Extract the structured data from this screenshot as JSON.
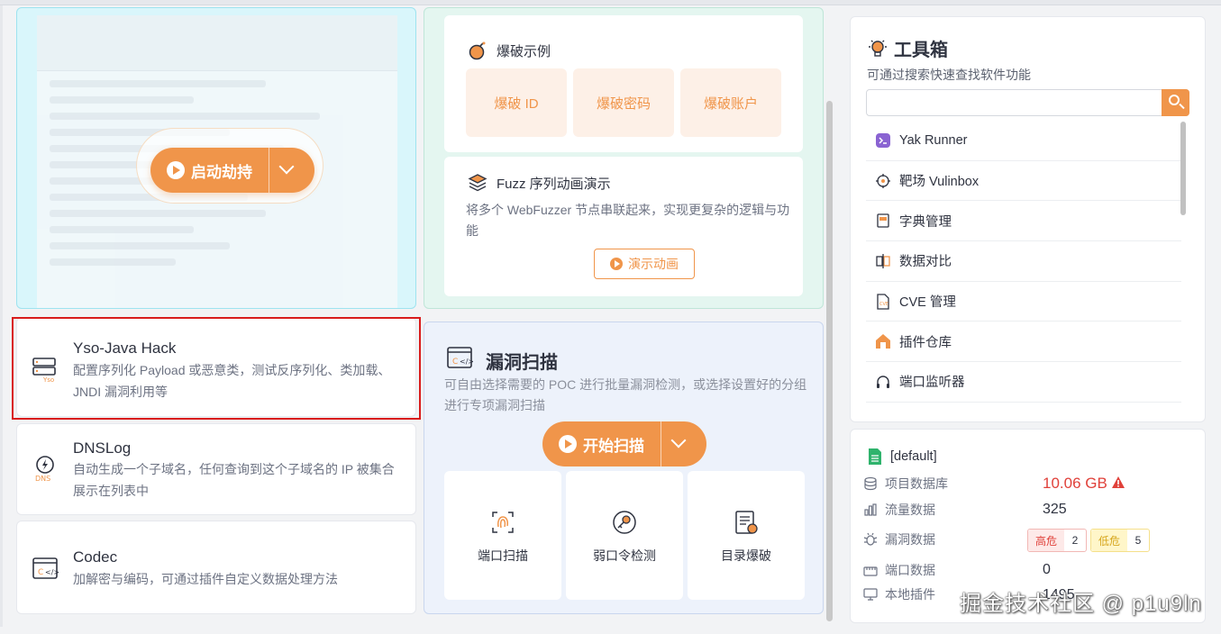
{
  "launch": {
    "start_label": "启动劫持"
  },
  "tools_left": {
    "yso": {
      "title": "Yso-Java Hack",
      "desc": "配置序列化 Payload 或恶意类，测试反序列化、类加载、JNDI 漏洞利用等"
    },
    "dnslog": {
      "title": "DNSLog",
      "desc": "自动生成一个子域名，任何查询到这个子域名的 IP 被集合展示在列表中"
    },
    "codec": {
      "title": "Codec",
      "desc": "加解密与编码，可通过插件自定义数据处理方法"
    }
  },
  "brute_example": {
    "title": "爆破示例",
    "tiles": [
      "爆破 ID",
      "爆破密码",
      "爆破账户"
    ]
  },
  "fuzz_demo": {
    "title": "Fuzz 序列动画演示",
    "desc": "将多个 WebFuzzer 节点串联起来，实现更复杂的逻辑与功能",
    "button": "演示动画"
  },
  "vuln_scan": {
    "title": "漏洞扫描",
    "desc": "可自由选择需要的 POC 进行批量漏洞检测，或选择设置好的分组进行专项漏洞扫描",
    "start_label": "开始扫描",
    "tiles": [
      "端口扫描",
      "弱口令检测",
      "目录爆破"
    ]
  },
  "toolbox": {
    "title": "工具箱",
    "subtitle": "可通过搜索快速查找软件功能",
    "search_value": "",
    "items": [
      {
        "label": "Yak Runner",
        "icon": "terminal-icon"
      },
      {
        "label": "靶场 Vulinbox",
        "icon": "target-icon"
      },
      {
        "label": "字典管理",
        "icon": "dictionary-icon"
      },
      {
        "label": "数据对比",
        "icon": "compare-icon"
      },
      {
        "label": "CVE 管理",
        "icon": "cve-icon"
      },
      {
        "label": "插件仓库",
        "icon": "store-icon"
      },
      {
        "label": "端口监听器",
        "icon": "headset-icon"
      }
    ]
  },
  "project": {
    "name": "[default]",
    "rows": [
      {
        "label": "项目数据库",
        "value": "10.06 GB"
      },
      {
        "label": "流量数据",
        "value": "325"
      },
      {
        "label": "漏洞数据",
        "value": ""
      },
      {
        "label": "端口数据",
        "value": "0"
      },
      {
        "label": "本地插件",
        "value": "1495"
      }
    ],
    "vuln_high_label": "高危",
    "vuln_high_count": "2",
    "vuln_low_label": "低危",
    "vuln_low_count": "5",
    "db_size_color": "#e0413a"
  },
  "watermark": "掘金技术社区 @ p1u9ln",
  "colors": {
    "accent": "#f0954a",
    "highlight_box": "#d91c1c"
  }
}
